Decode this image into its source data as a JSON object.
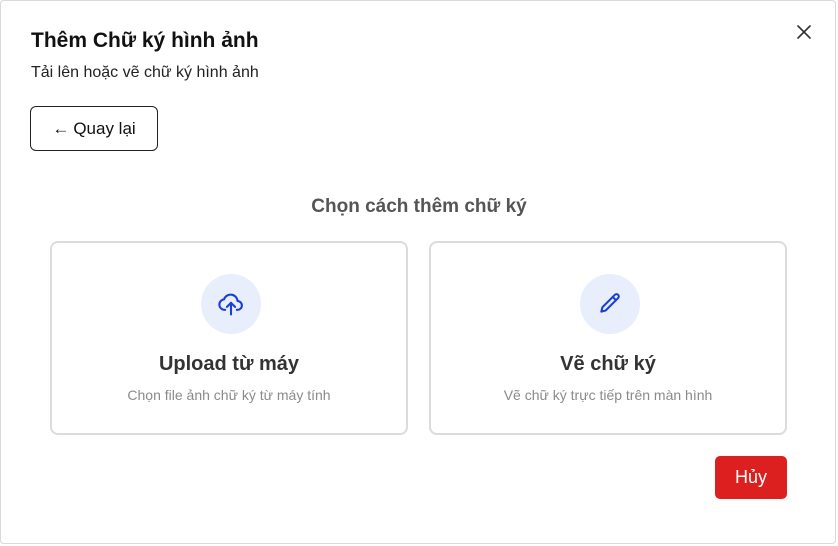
{
  "dialog": {
    "title": "Thêm Chữ ký hình ảnh",
    "subtitle": "Tải lên hoặc vẽ chữ ký hình ảnh",
    "close_icon": "close-icon"
  },
  "back_button": {
    "arrow": "←",
    "label": "Quay lại"
  },
  "section_heading": "Chọn cách thêm chữ ký",
  "options": [
    {
      "icon": "cloud-upload-icon",
      "title": "Upload từ máy",
      "description": "Chọn file ảnh chữ ký từ máy tính"
    },
    {
      "icon": "pencil-icon",
      "title": "Vẽ chữ ký",
      "description": "Vẽ chữ ký trực tiếp trên màn hình"
    }
  ],
  "cancel_button": {
    "label": "Hủy"
  },
  "colors": {
    "accent_blue": "#1a3fd6",
    "icon_bg": "#e8eefc",
    "cancel_red": "#dc1f1f"
  }
}
